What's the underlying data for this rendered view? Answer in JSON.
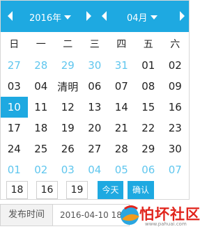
{
  "header": {
    "year_label": "2016年",
    "month_label": "04月"
  },
  "weekdays": [
    "日",
    "一",
    "二",
    "三",
    "四",
    "五",
    "六"
  ],
  "weeks": [
    [
      {
        "t": "27",
        "o": true
      },
      {
        "t": "28",
        "o": true
      },
      {
        "t": "29",
        "o": true
      },
      {
        "t": "30",
        "o": true
      },
      {
        "t": "31",
        "o": true
      },
      {
        "t": "01"
      },
      {
        "t": "02"
      }
    ],
    [
      {
        "t": "03"
      },
      {
        "t": "04"
      },
      {
        "t": "清明"
      },
      {
        "t": "06"
      },
      {
        "t": "07"
      },
      {
        "t": "08"
      },
      {
        "t": "09"
      }
    ],
    [
      {
        "t": "10",
        "sel": true
      },
      {
        "t": "11"
      },
      {
        "t": "12"
      },
      {
        "t": "13"
      },
      {
        "t": "14"
      },
      {
        "t": "15"
      },
      {
        "t": "16"
      }
    ],
    [
      {
        "t": "17"
      },
      {
        "t": "18"
      },
      {
        "t": "19"
      },
      {
        "t": "20"
      },
      {
        "t": "21"
      },
      {
        "t": "22"
      },
      {
        "t": "23"
      }
    ],
    [
      {
        "t": "24"
      },
      {
        "t": "25"
      },
      {
        "t": "26"
      },
      {
        "t": "27"
      },
      {
        "t": "28"
      },
      {
        "t": "29"
      },
      {
        "t": "30"
      }
    ],
    [
      {
        "t": "01",
        "o": true
      },
      {
        "t": "02",
        "o": true
      },
      {
        "t": "03",
        "o": true
      },
      {
        "t": "04",
        "o": true
      },
      {
        "t": "05",
        "o": true
      },
      {
        "t": "06",
        "o": true
      },
      {
        "t": "07",
        "o": true
      }
    ]
  ],
  "time": {
    "hour": "18",
    "minute": "16",
    "second": "19"
  },
  "buttons": {
    "today": "今天",
    "confirm": "确认"
  },
  "field": {
    "label": "发布时间",
    "value": "2016-04-10 18:16:19"
  },
  "watermark": {
    "name": "怕坏社区",
    "url": "www.pahuai.com"
  },
  "colors": {
    "accent": "#1ea9e1",
    "other_month_text": "#5fc6ee",
    "watermark_red": "#e1241c"
  }
}
